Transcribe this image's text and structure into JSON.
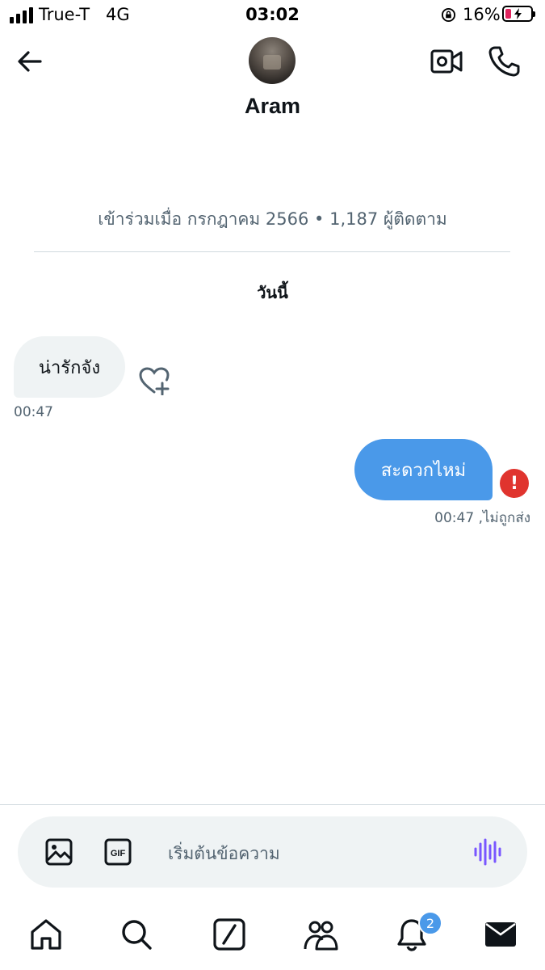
{
  "status_bar": {
    "carrier": "True-T",
    "network": "4G",
    "time": "03:02",
    "battery_percent": "16%",
    "battery_level": 0.16
  },
  "header": {
    "contact_name": "Aram",
    "back_icon": "arrow-left-icon",
    "video_icon": "video-call-icon",
    "phone_icon": "phone-icon"
  },
  "profile_info": {
    "joined_text": "เข้าร่วมเมื่อ กรกฎาคม 2566 • 1,187 ผู้ติดตาม"
  },
  "date_separator": "วันนี้",
  "messages": [
    {
      "direction": "incoming",
      "text": "น่ารักจัง",
      "time": "00:47"
    },
    {
      "direction": "outgoing",
      "text": "สะดวกไหม่",
      "time": "00:47 ,ไม่ถูกส่ง",
      "error": "!"
    }
  ],
  "composer": {
    "placeholder": "เริ่มต้นข้อความ",
    "image_icon": "image-icon",
    "gif_icon": "gif-icon",
    "voice_icon": "voice-message-icon"
  },
  "tab_bar": {
    "items": [
      "home-icon",
      "search-icon",
      "grok-icon",
      "communities-icon",
      "notifications-icon",
      "messages-icon"
    ],
    "notifications_badge": "2"
  },
  "colors": {
    "accent": "#4a99e9",
    "error": "#e0342e",
    "bubble_incoming": "#eff3f4",
    "secondary_text": "#536471"
  }
}
